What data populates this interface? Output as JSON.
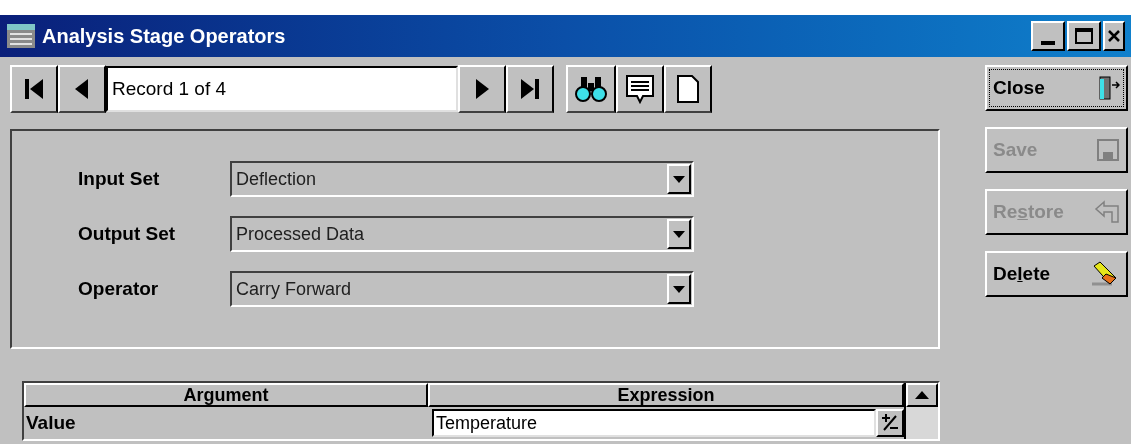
{
  "window": {
    "title": "Analysis Stage Operators"
  },
  "navigator": {
    "record": "Record 1 of 4"
  },
  "fields": [
    {
      "label": "Input Set",
      "value": "Deflection"
    },
    {
      "label": "Output Set",
      "value": "Processed Data"
    },
    {
      "label": "Operator",
      "value": "Carry Forward"
    }
  ],
  "side_buttons": [
    {
      "kind": "close",
      "before": "Close",
      "disabled": false,
      "focused": true
    },
    {
      "kind": "save",
      "before": "Save",
      "disabled": true,
      "focused": false
    },
    {
      "kind": "restore",
      "before": "Re",
      "mnemonic": "s",
      "after": "tore",
      "disabled": true,
      "focused": false
    },
    {
      "kind": "delete",
      "before": "De",
      "mnemonic": "l",
      "after": "ete",
      "disabled": false,
      "focused": false
    }
  ],
  "grid": {
    "columns": [
      "Argument",
      "Expression"
    ],
    "rows": [
      {
        "argument": "Value",
        "expression": "Temperature"
      }
    ]
  }
}
